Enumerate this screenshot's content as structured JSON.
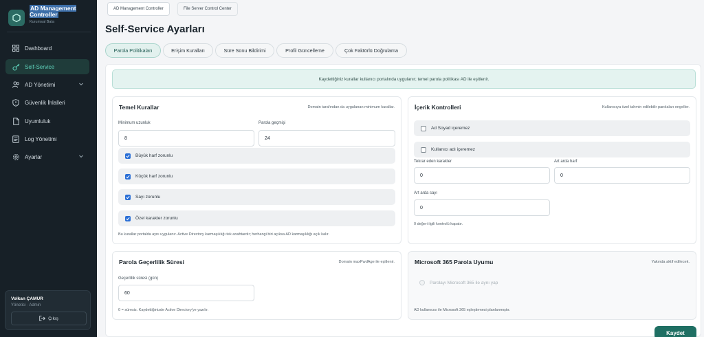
{
  "brand": {
    "title": "AD Management Controller",
    "subtitle": "Kurumsal Bata"
  },
  "sidebar": {
    "items": [
      {
        "label": "Dashboard",
        "icon": "grid-icon"
      },
      {
        "label": "Self-Service",
        "icon": "key-icon",
        "active": true
      },
      {
        "label": "AD Yönetimi",
        "icon": "users-icon",
        "expandable": true
      },
      {
        "label": "Güvenlik İhlalleri",
        "icon": "shield-icon"
      },
      {
        "label": "Uyumluluk",
        "icon": "document-icon"
      },
      {
        "label": "Log Yönetimi",
        "icon": "log-icon"
      },
      {
        "label": "Ayarlar",
        "icon": "gear-icon",
        "expandable": true
      }
    ]
  },
  "user": {
    "name": "Volkan ÇAMUR",
    "role": "Yönetici · Admin",
    "logout_label": "Çıkış"
  },
  "top_tabs": [
    {
      "label": "AD Management Controller",
      "active": true
    },
    {
      "label": "File Server Control Center",
      "active": false
    }
  ],
  "page_title": "Self-Service Ayarları",
  "sub_tabs": [
    {
      "label": "Parola Politikaları",
      "active": true
    },
    {
      "label": "Erişim Kuralları"
    },
    {
      "label": "Süre Sonu Bildirimi"
    },
    {
      "label": "Profil Güncelleme"
    },
    {
      "label": "Çok Faktörlü Doğrulama"
    }
  ],
  "info_banner": "Kaydettiğiniz kurallar kullanıcı portalında uygulanır; temel parola politikası AD ile eşitlenir.",
  "basic_rules": {
    "title": "Temel Kurallar",
    "note": "Domain tarafından da uygulanan minimum kurallar.",
    "min_length_label": "Minimum uzunluk",
    "min_length_value": "8",
    "history_label": "Parola geçmişi",
    "history_value": "24",
    "checks": [
      {
        "label": "Büyük harf zorunlu",
        "checked": true
      },
      {
        "label": "Küçük harf zorunlu",
        "checked": true
      },
      {
        "label": "Sayı zorunlu",
        "checked": true
      },
      {
        "label": "Özel karakter zorunlu",
        "checked": true
      }
    ],
    "footnote": "Bu kurallar portalda aynı uygulanır. Active Directory karmaşıklığı tek anahtardır; herhangi biri açıksa AD karmaşıklığı açık kalır."
  },
  "content_controls": {
    "title": "İçerik Kontrolleri",
    "note": "Kullanıcıya özel tahmin edilebilir parolaları engeller.",
    "checks": [
      {
        "label": "Ad Soyad içeremez",
        "checked": false
      },
      {
        "label": "Kullanıcı adı içeremez",
        "checked": false
      }
    ],
    "repeat_label": "Tekrar eden karakter",
    "repeat_value": "0",
    "seq_letter_label": "Art arda harf",
    "seq_letter_value": "0",
    "seq_number_label": "Art arda sayı",
    "seq_number_value": "0",
    "footnote": "0 değeri ilgili kontrolü kapatır."
  },
  "validity": {
    "title": "Parola Geçerlilik Süresi",
    "note": "Domain maxPwdAge ile eşitlenir.",
    "label": "Geçerlilik süresi (gün)",
    "value": "60",
    "footnote": "0 = süresiz. Kaydettiğinizde Active Directory'ye yazılır."
  },
  "m365": {
    "title": "Microsoft 365 Parola Uyumu",
    "note": "Yakında aktif edilecek.",
    "option_label": "Parolayı Microsoft 365 ile aynı yap",
    "footnote": "AD kullanıcısı ile Microsoft 365 eşleştirmesi planlanmıştır."
  },
  "save_label": "Kaydet",
  "colors": {
    "accent": "#1f6f63",
    "sidebar": "#172027",
    "checkbox": "#2a6fd6"
  }
}
